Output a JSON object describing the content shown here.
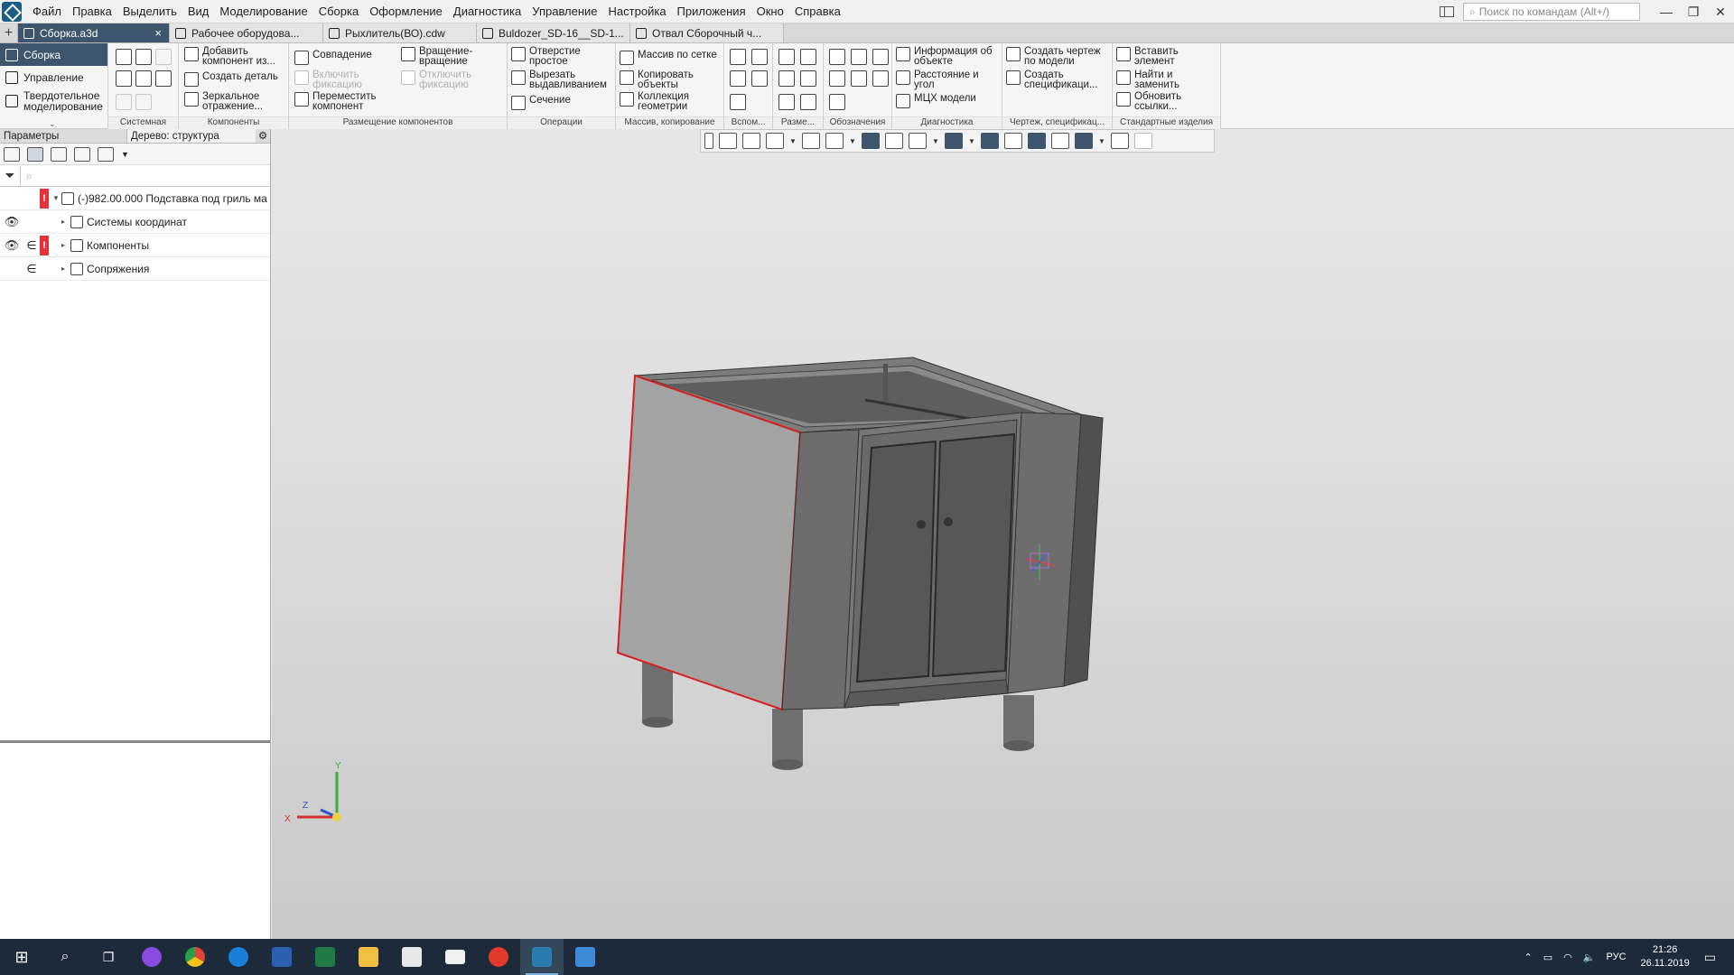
{
  "menu": {
    "items": [
      "Файл",
      "Правка",
      "Выделить",
      "Вид",
      "Моделирование",
      "Сборка",
      "Оформление",
      "Диагностика",
      "Управление",
      "Настройка",
      "Приложения",
      "Окно",
      "Справка"
    ],
    "search_placeholder": "Поиск по командам (Alt+/)"
  },
  "tabs": [
    {
      "label": "Сборка.a3d",
      "active": true,
      "close": "×"
    },
    {
      "label": "Рабочее оборудова...",
      "active": false
    },
    {
      "label": "Рыхлитель(ВО).cdw",
      "active": false
    },
    {
      "label": "Buldozer_SD-16__SD-1...",
      "active": false
    },
    {
      "label": "Отвал Сборочный ч...",
      "active": false
    }
  ],
  "modes": {
    "items": [
      "Сборка",
      "Управление",
      "Твердотельное моделирование"
    ]
  },
  "ribbon": {
    "groups": {
      "sys": "Системная",
      "components": "Компоненты",
      "placement": "Размещение компонентов",
      "operations": "Операции",
      "array": "Массив, копирование",
      "aux": "Вспом...",
      "size": "Разме...",
      "designations": "Обозначения",
      "diagnostics": "Диагностика",
      "drawing": "Чертеж, спецификац...",
      "standard": "Стандартные изделия"
    },
    "buttons": {
      "add_component": "Добавить компонент из...",
      "create_part": "Создать деталь",
      "mirror": "Зеркальное отражение...",
      "coincidence": "Совпадение",
      "enable_fix": "Включить фиксацию",
      "move_component": "Переместить компонент",
      "rotation": "Вращение-вращение",
      "disable_fix": "Отключить фиксацию",
      "hole": "Отверстие простое",
      "cut_extrude": "Вырезать выдавливанием",
      "section": "Сечение",
      "grid_array": "Массив по сетке",
      "copy_objects": "Копировать объекты",
      "geom_collection": "Коллекция геометрии",
      "object_info": "Информация об объекте",
      "distance_angle": "Расстояние и угол",
      "mass_props": "МЦХ модели",
      "create_drawing": "Создать чертеж по модели",
      "create_spec": "Создать спецификаци...",
      "insert_element": "Вставить элемент",
      "find_replace": "Найти и заменить",
      "update_links": "Обновить ссылки..."
    }
  },
  "left_panel": {
    "tab_params": "Параметры",
    "tab_tree": "Дерево: структура",
    "search_icon": "⌕",
    "tree": [
      {
        "label": "(-)982.00.000 Подставка под гриль ма",
        "eye": "",
        "inc": "",
        "err": "!",
        "expanded": true
      },
      {
        "label": "Системы координат",
        "eye": "👁",
        "inc": "",
        "err": "",
        "expanded": false
      },
      {
        "label": "Компоненты",
        "eye": "👁",
        "inc": "∈",
        "err": "!",
        "expanded": false
      },
      {
        "label": "Сопряжения",
        "eye": "",
        "inc": "∈",
        "err": "",
        "expanded": false
      }
    ]
  },
  "axes": {
    "x": "X",
    "y": "Y",
    "z": "Z"
  },
  "taskbar": {
    "lang": "РУС",
    "time": "21:26",
    "date": "26.11.2019"
  },
  "colors": {
    "accent": "#3d566e",
    "error": "#e5323a",
    "taskbar": "#1c2a3a"
  }
}
